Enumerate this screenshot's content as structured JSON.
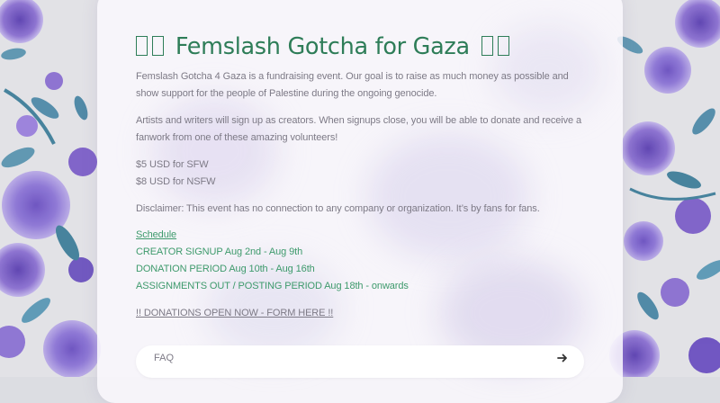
{
  "title": "Femslash Gotcha for Gaza",
  "intro": "Femslash Gotcha 4 Gaza is a fundraising event. Our goal is to raise as much money as possible and show support for the people of Palestine during the ongoing genocide.",
  "signup_info": "Artists and writers will sign up as creators. When signups close, you will be able to donate and receive a fanwork from one of these amazing volunteers!",
  "prices": [
    "$5 USD for SFW",
    "$8 USD for NSFW"
  ],
  "disclaimer": "Disclaimer: This event has no connection to any company or organization. It’s by fans for fans.",
  "schedule": {
    "link_label": "Schedule",
    "items": [
      "CREATOR SIGNUP Aug 2nd - Aug 9th",
      "DONATION PERIOD Aug 10th - Aug 16th",
      "ASSIGNMENTS OUT / POSTING PERIOD Aug 18th - onwards"
    ]
  },
  "donate_link": "!! DONATIONS OPEN NOW - FORM HERE !!",
  "faq": {
    "label": "FAQ",
    "icon": "arrow-right-icon"
  },
  "colors": {
    "accent": "#2e7d58",
    "link_green": "#3e9a6c",
    "text": "#7d7a86",
    "flower_purple": "#7b5cc8"
  }
}
